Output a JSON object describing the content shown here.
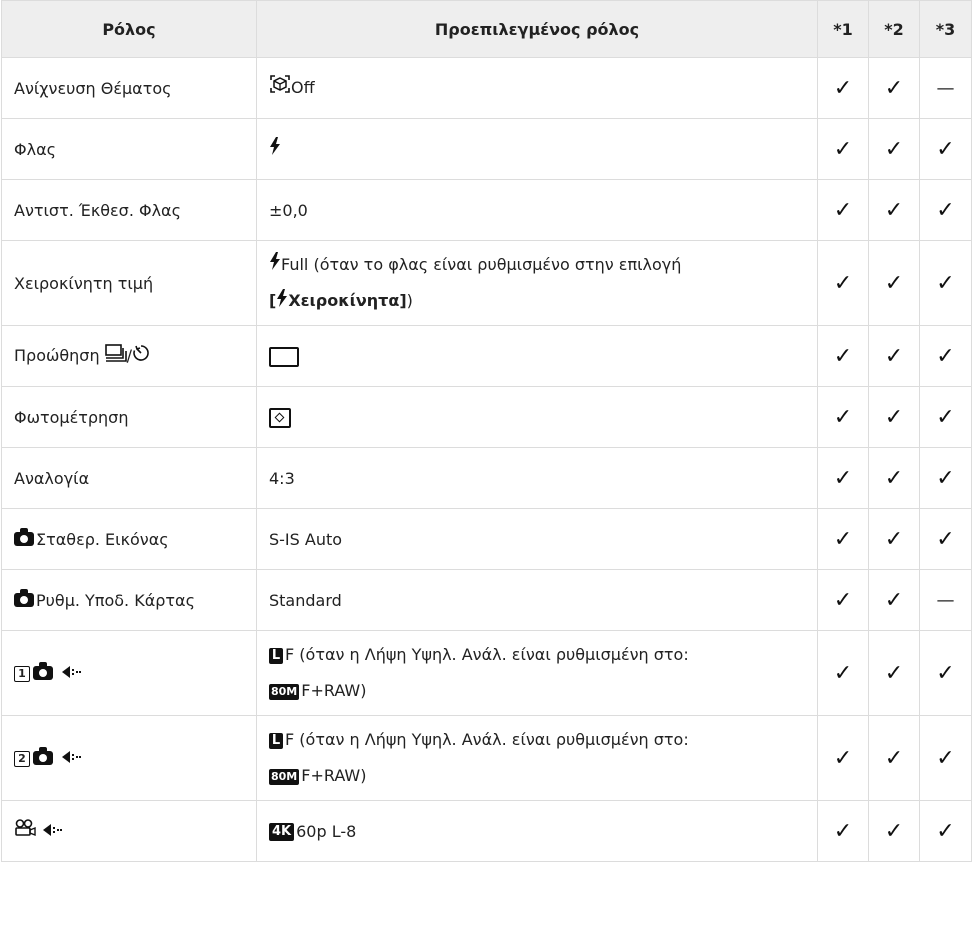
{
  "header": {
    "col_role": "Ρόλος",
    "col_default": "Προεπιλεγμένος ρόλος",
    "col_1": "*1",
    "col_2": "*2",
    "col_3": "*3"
  },
  "marks": {
    "check": "✓",
    "dash": "—"
  },
  "rows": [
    {
      "role": "Ανίχνευση Θέματος",
      "default": "Off",
      "c1": true,
      "c2": true,
      "c3": false
    },
    {
      "role": "Φλας",
      "default": "",
      "c1": true,
      "c2": true,
      "c3": true
    },
    {
      "role": "Αντιστ. Έκθεσ. Φλας",
      "default": "±0,0",
      "c1": true,
      "c2": true,
      "c3": true
    },
    {
      "role": "Χειροκίνητη τιμή",
      "default_pre": "Full (όταν το φλας είναι ρυθμισμένο στην επιλογή",
      "default_b_open": "[",
      "default_b_text": "Χειροκίνητα]",
      "default_post": ")",
      "c1": true,
      "c2": true,
      "c3": true
    },
    {
      "role": "Προώθηση ",
      "role_sep": "/",
      "default": "",
      "c1": true,
      "c2": true,
      "c3": true
    },
    {
      "role": "Φωτομέτρηση",
      "default": "",
      "c1": true,
      "c2": true,
      "c3": true
    },
    {
      "role": "Αναλογία",
      "default": "4:3",
      "c1": true,
      "c2": true,
      "c3": true
    },
    {
      "role": "Σταθερ. Εικόνας",
      "default": "S-IS Auto",
      "c1": true,
      "c2": true,
      "c3": true
    },
    {
      "role": "Ρυθμ. Υποδ. Κάρτας",
      "default": "Standard",
      "c1": true,
      "c2": true,
      "c3": false
    },
    {
      "role_num": "1",
      "default_l": "L",
      "default_line1": "F (όταν η Λήψη Υψηλ. Ανάλ. είναι ρυθμισμένη στο:",
      "default_b80": "80M",
      "default_line2": "F+RAW)",
      "c1": true,
      "c2": true,
      "c3": true
    },
    {
      "role_num": "2",
      "default_l": "L",
      "default_line1": "F (όταν η Λήψη Υψηλ. Ανάλ. είναι ρυθμισμένη στο:",
      "default_b80": "80M",
      "default_line2": "F+RAW)",
      "c1": true,
      "c2": true,
      "c3": true
    },
    {
      "default_badge": "4K",
      "default": "60p L-8",
      "c1": true,
      "c2": true,
      "c3": true
    }
  ]
}
